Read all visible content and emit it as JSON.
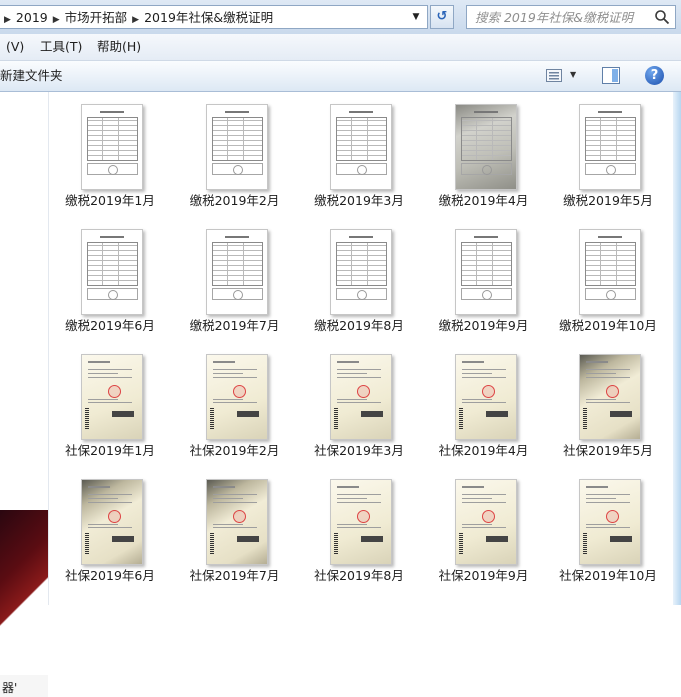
{
  "address_bar": {
    "breadcrumbs": [
      "2019",
      "市场开拓部",
      "2019年社保&缴税证明"
    ],
    "search_placeholder": "搜索 2019年社保&缴税证明"
  },
  "menu": {
    "items": [
      "(V)",
      "工具(T)",
      "帮助(H)"
    ]
  },
  "toolbar": {
    "new_folder_label": "新建文件夹"
  },
  "nav_pane": {
    "truncated_label": "器'"
  },
  "files": [
    {
      "name": "缴税2019年1月",
      "kind": "tax"
    },
    {
      "name": "缴税2019年2月",
      "kind": "tax"
    },
    {
      "name": "缴税2019年3月",
      "kind": "tax"
    },
    {
      "name": "缴税2019年4月",
      "kind": "tax-photo"
    },
    {
      "name": "缴税2019年5月",
      "kind": "tax"
    },
    {
      "name": "缴税2019年6月",
      "kind": "tax"
    },
    {
      "name": "缴税2019年7月",
      "kind": "tax"
    },
    {
      "name": "缴税2019年8月",
      "kind": "tax"
    },
    {
      "name": "缴税2019年9月",
      "kind": "tax"
    },
    {
      "name": "缴税2019年10月",
      "kind": "tax"
    },
    {
      "name": "社保2019年1月",
      "kind": "social"
    },
    {
      "name": "社保2019年2月",
      "kind": "social"
    },
    {
      "name": "社保2019年3月",
      "kind": "social"
    },
    {
      "name": "社保2019年4月",
      "kind": "social"
    },
    {
      "name": "社保2019年5月",
      "kind": "social-shaded"
    },
    {
      "name": "社保2019年6月",
      "kind": "social-shaded"
    },
    {
      "name": "社保2019年7月",
      "kind": "social-shaded"
    },
    {
      "name": "社保2019年8月",
      "kind": "social"
    },
    {
      "name": "社保2019年9月",
      "kind": "social"
    },
    {
      "name": "社保2019年10月",
      "kind": "social"
    }
  ],
  "colors": {
    "accent_blue": "#1b4fae",
    "chrome_gradient_top": "#dfe9f5",
    "chrome_gradient_bottom": "#c9d9ec"
  },
  "icons": {
    "breadcrumb_separator": "chevron-right-icon",
    "refresh": "refresh-icon",
    "search": "search-icon",
    "view": "view-icon",
    "preview_pane": "preview-pane-icon",
    "help": "help-icon"
  }
}
